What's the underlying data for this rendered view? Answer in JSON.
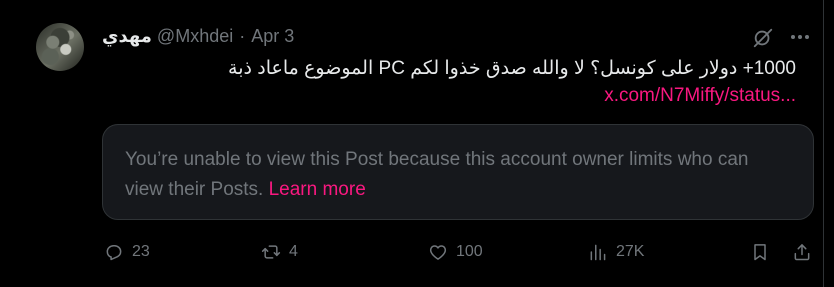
{
  "post": {
    "author": {
      "display_name": "مهدي",
      "handle": "@Mxhdei",
      "separator": "·",
      "date": "Apr 3"
    },
    "text": "1000+ دولار على كونسل؟ لا والله صدق خذوا لكم PC الموضوع ماعاد ذبة",
    "link": "x.com/N7Miffy/status..."
  },
  "notice": {
    "message": "You’re unable to view this Post because this account owner limits who can view their Posts.",
    "link_label": "Learn more"
  },
  "actions": {
    "replies": "23",
    "reposts": "4",
    "likes": "100",
    "views": "27K"
  },
  "colors": {
    "background": "#000000",
    "text": "#e7e9ea",
    "muted": "#71767b",
    "accent": "#f91880",
    "card": "#16181c",
    "border": "#2f3336"
  },
  "icons": [
    "grok-icon",
    "more-icon",
    "reply-icon",
    "repost-icon",
    "like-icon",
    "views-icon",
    "bookmark-icon",
    "share-icon"
  ]
}
